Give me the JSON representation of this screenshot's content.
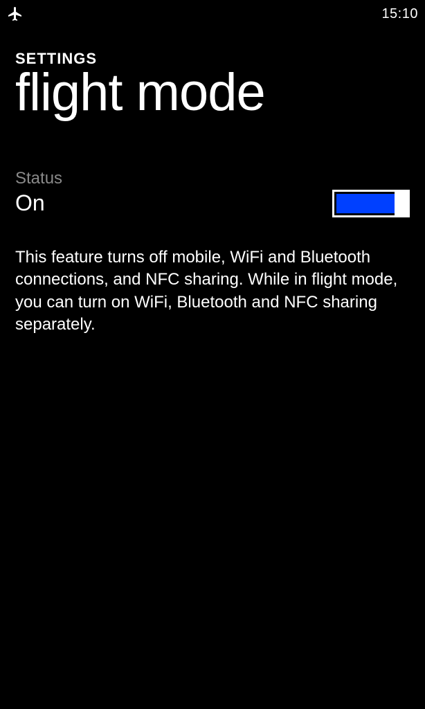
{
  "status_bar": {
    "time": "15:10"
  },
  "header": {
    "breadcrumb": "SETTINGS",
    "title": "flight mode"
  },
  "status": {
    "label": "Status",
    "value": "On"
  },
  "description": "This feature turns off mobile, WiFi and Bluetooth connections, and NFC sharing. While in flight mode, you can turn on WiFi, Bluetooth and NFC sharing separately."
}
